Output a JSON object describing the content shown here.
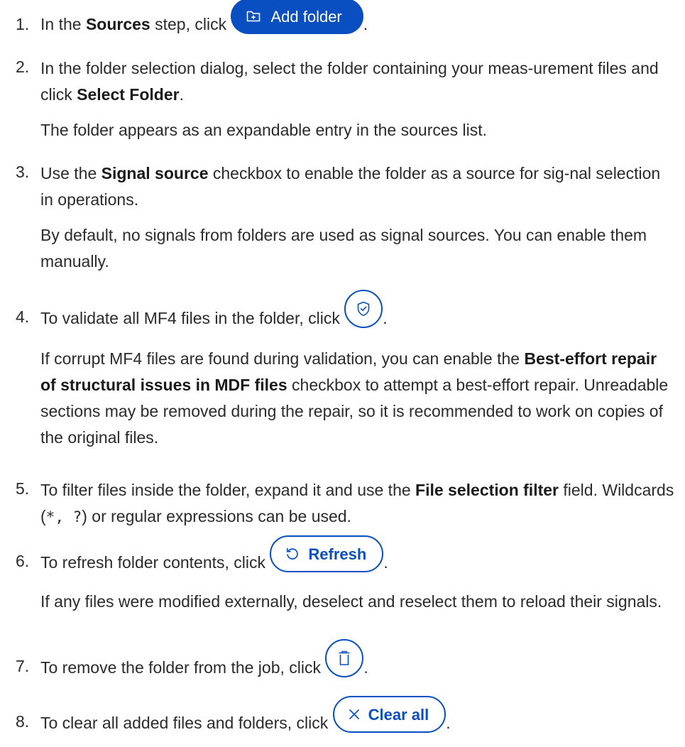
{
  "steps": [
    {
      "number": "1.",
      "text_before": "In the ",
      "bold": "Sources",
      "text_after": " step, click ",
      "button_label": "Add folder",
      "button_icon": "folder-add-icon",
      "end": "."
    },
    {
      "number": "2.",
      "text_before": "In the folder selection dialog, select the folder containing your meas-urement files and click ",
      "bold": "Select Folder",
      "end": ".",
      "note": "The folder appears as an expandable entry in the sources list."
    },
    {
      "number": "3.",
      "text_before": "Use the ",
      "bold": "Signal source",
      "text_after": " checkbox to enable the folder as a source for sig-nal selection in operations.",
      "note": "By default, no signals from folders are used as signal sources. You can enable them manually."
    },
    {
      "number": "4.",
      "text_before": "To validate all MF4 files in the folder, click ",
      "button_icon": "shield-check-icon",
      "end": ".",
      "note_before": "If corrupt MF4 files are found during validation, you can enable the ",
      "note_bold": "Best-effort repair of structural issues in MDF files",
      "note_after": " checkbox to attempt a best-effort repair. Unreadable sections may be removed during the repair, so it is recommended to work on copies of the original files."
    },
    {
      "number": "5.",
      "text_before": "To filter files inside the folder, expand it and use the ",
      "bold": "File selection filter",
      "text_after": " field. Wildcards (",
      "code": "*, ?",
      "text_end": ") or regular expressions can be used."
    },
    {
      "number": "6.",
      "text_before": "To refresh folder contents, click ",
      "button_label": "Refresh",
      "button_icon": "refresh-icon",
      "end": ".",
      "note": "If any files were modified externally, deselect and reselect them to reload their signals."
    },
    {
      "number": "7.",
      "text_before": "To remove the folder from the job, click ",
      "button_icon": "trash-icon",
      "end": "."
    },
    {
      "number": "8.",
      "text_before": "To clear all added files and folders, click ",
      "button_label": "Clear all",
      "button_icon": "close-icon",
      "end": "."
    }
  ],
  "colors": {
    "accent": "#0a4fc2",
    "text": "#2b2b2b"
  }
}
